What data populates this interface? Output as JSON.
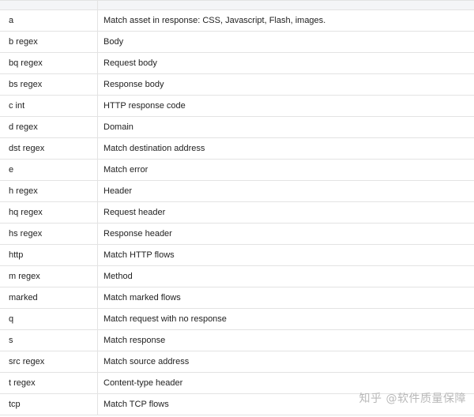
{
  "table": {
    "rows": [
      {
        "key": "a",
        "desc": "Match asset in response: CSS, Javascript, Flash, images."
      },
      {
        "key": "b regex",
        "desc": "Body"
      },
      {
        "key": "bq regex",
        "desc": "Request body"
      },
      {
        "key": "bs regex",
        "desc": "Response body"
      },
      {
        "key": "c int",
        "desc": "HTTP response code"
      },
      {
        "key": "d regex",
        "desc": "Domain"
      },
      {
        "key": "dst regex",
        "desc": "Match destination address"
      },
      {
        "key": "e",
        "desc": "Match error"
      },
      {
        "key": "h regex",
        "desc": "Header"
      },
      {
        "key": "hq regex",
        "desc": "Request header"
      },
      {
        "key": "hs regex",
        "desc": "Response header"
      },
      {
        "key": "http",
        "desc": "Match HTTP flows"
      },
      {
        "key": "m regex",
        "desc": "Method"
      },
      {
        "key": "marked",
        "desc": "Match marked flows"
      },
      {
        "key": "q",
        "desc": "Match request with no response"
      },
      {
        "key": "s",
        "desc": "Match response"
      },
      {
        "key": "src regex",
        "desc": "Match source address"
      },
      {
        "key": "t regex",
        "desc": "Content-type header"
      },
      {
        "key": "tcp",
        "desc": "Match TCP flows"
      }
    ]
  },
  "watermark": "知乎 @软件质量保障"
}
